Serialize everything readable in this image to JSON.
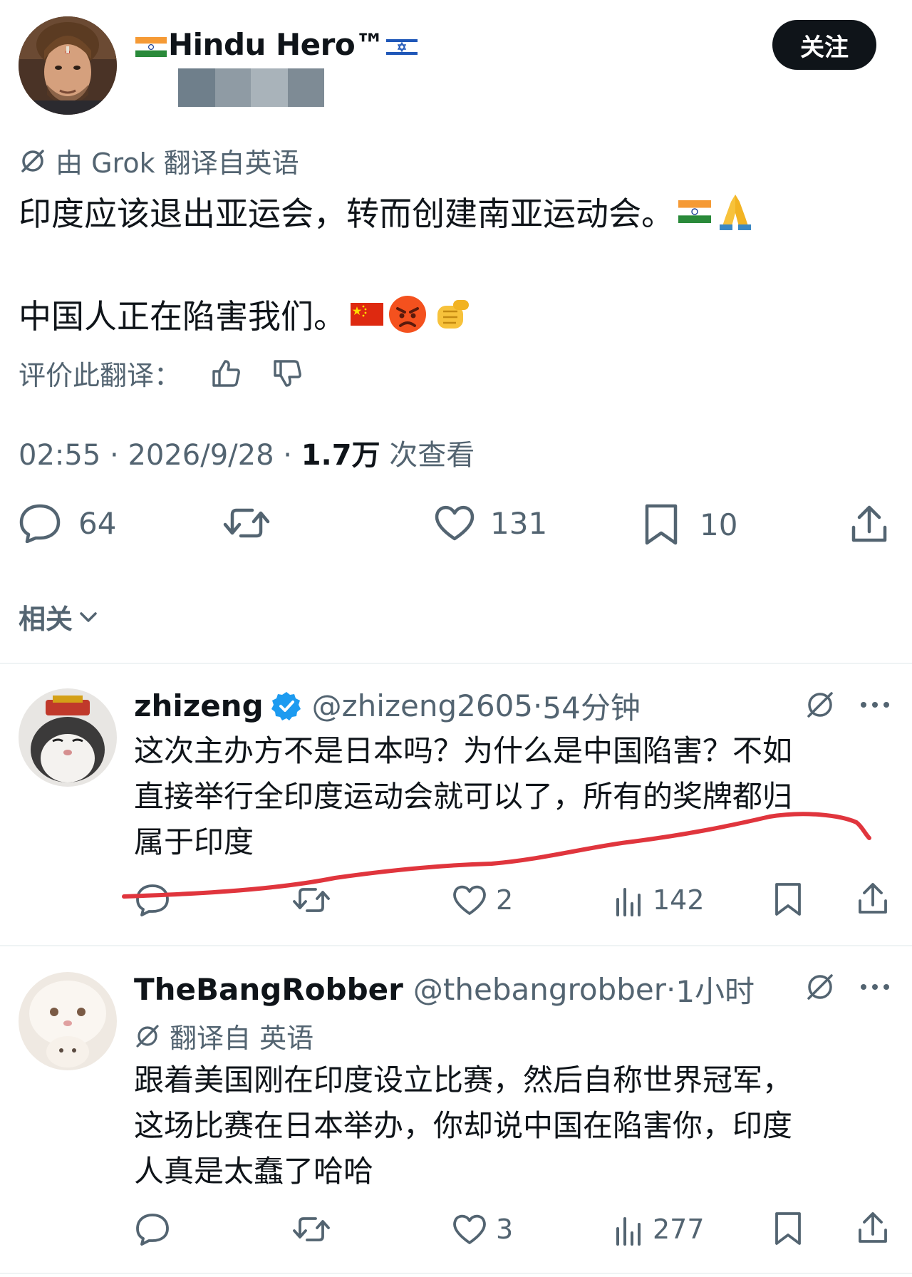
{
  "main_tweet": {
    "author_name": "Hindu Hero™",
    "follow_label": "关注",
    "translation_note": "由 Grok 翻译自英语",
    "text_line_1": "印度应该退出亚运会，转而创建南亚运动会。",
    "text_line_2": "中国人正在陷害我们。",
    "rate_label": "评价此翻译：",
    "time": "02:55",
    "date": "2026/9/28",
    "views_count": "1.7万",
    "views_label": "次查看",
    "replies": "64",
    "likes": "131",
    "bookmarks": "10"
  },
  "related_label": "相关",
  "replies": [
    {
      "name": "zhizeng",
      "verified": true,
      "handle": "@zhizeng2605",
      "time": "54分钟",
      "lines": [
        "这次主办方不是日本吗？为什么是中国陷害？不如",
        "直接举行全印度运动会就可以了，所有的奖牌都归",
        "属于印度"
      ],
      "likes": "2",
      "views": "142"
    },
    {
      "name": "TheBangRobber",
      "handle": "@thebangrobber",
      "time": "1小时",
      "translation_note": "翻译自 英语",
      "lines": [
        "跟着美国刚在印度设立比赛，然后自称世界冠军，",
        "这场比赛在日本举办，你却说中国在陷害你，印度",
        "人真是太蠢了哈哈"
      ],
      "likes": "3",
      "views": "277"
    }
  ],
  "colors": {
    "text": "#0f1419",
    "secondary": "#536471",
    "verified": "#1d9bf0",
    "annotation": "#e0353d"
  }
}
